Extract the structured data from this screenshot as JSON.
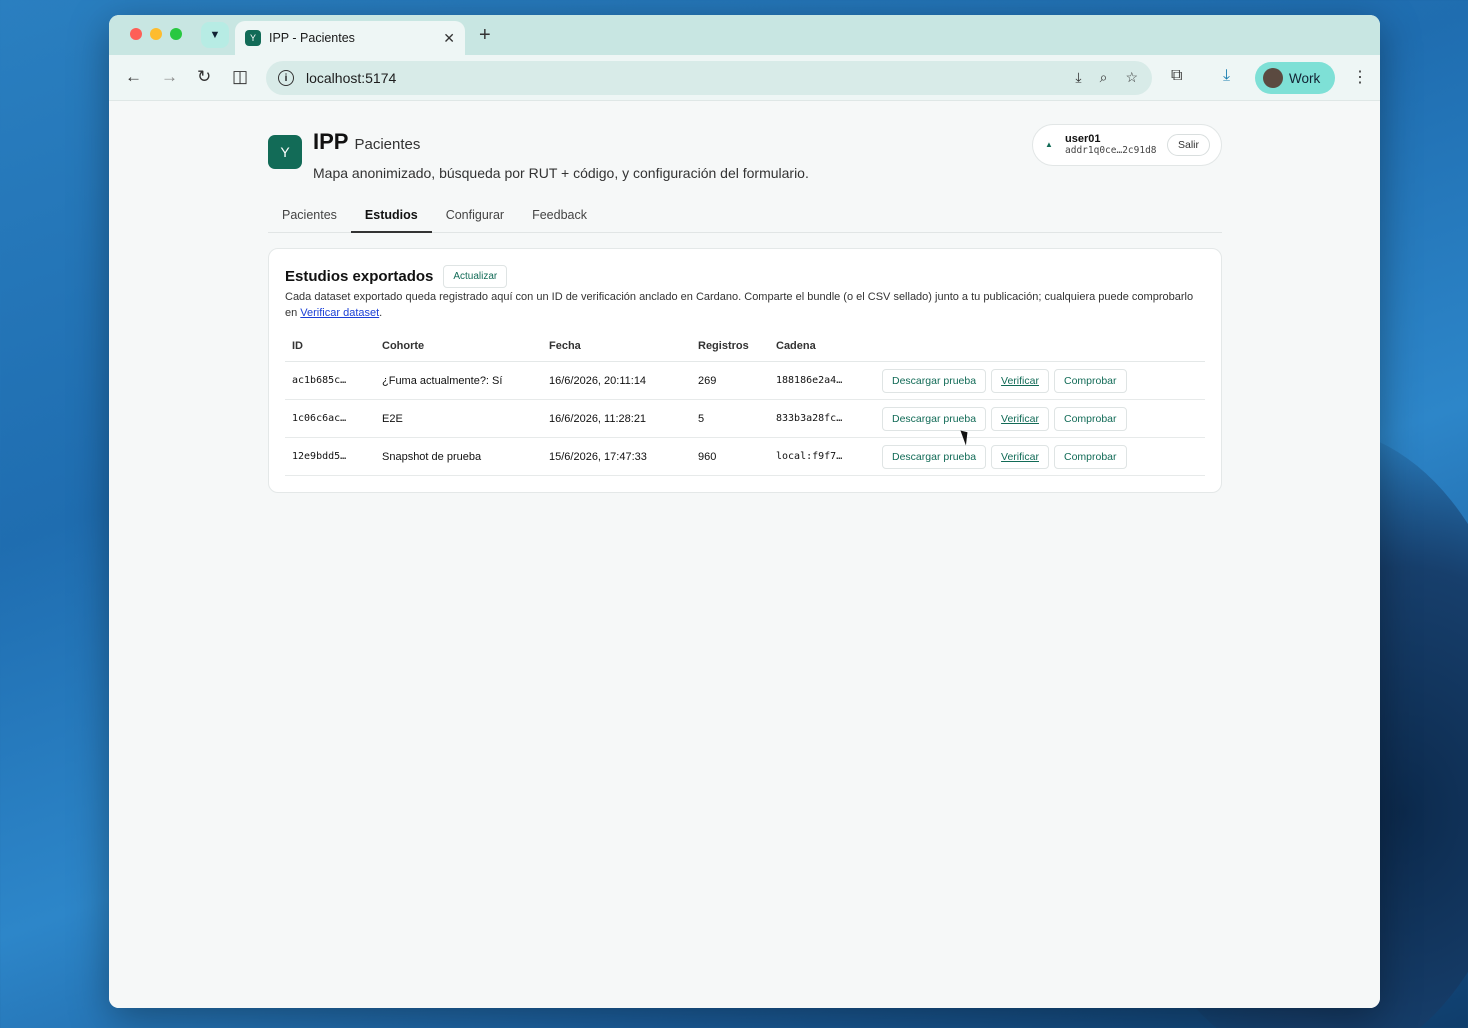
{
  "browser": {
    "tab_title": "IPP - Pacientes",
    "url": "localhost:5174",
    "profile_label": "Work"
  },
  "header": {
    "brand": "IPP",
    "brand_sub": "Pacientes",
    "tagline": "Mapa anonimizado, búsqueda por RUT + código, y configuración del formulario.",
    "user": {
      "name": "user01",
      "address": "addr1q0ce…2c91d8",
      "logout_label": "Salir"
    }
  },
  "tabs": [
    {
      "label": "Pacientes"
    },
    {
      "label": "Estudios"
    },
    {
      "label": "Configurar"
    },
    {
      "label": "Feedback"
    }
  ],
  "studies": {
    "title": "Estudios exportados",
    "refresh_label": "Actualizar",
    "description": "Cada dataset exportado queda registrado aquí con un ID de verificación anclado en Cardano. Comparte el bundle (o el CSV sellado) junto a tu publicación; cualquiera puede comprobarlo en ",
    "description_link": "Verificar dataset",
    "description_end": ".",
    "columns": [
      "ID",
      "Cohorte",
      "Fecha",
      "Registros",
      "Cadena"
    ],
    "rows": [
      {
        "id": "ac1b685c…",
        "cohort": "¿Fuma actualmente?: Sí",
        "date": "16/6/2026, 20:11:14",
        "records": "269",
        "chain": "188186e2a4…"
      },
      {
        "id": "1c06c6ac…",
        "cohort": "E2E",
        "date": "16/6/2026, 11:28:21",
        "records": "5",
        "chain": "833b3a28fc…"
      },
      {
        "id": "12e9bdd5…",
        "cohort": "Snapshot de prueba",
        "date": "15/6/2026, 17:47:33",
        "records": "960",
        "chain": "local:f9f7…"
      }
    ],
    "actions": {
      "download": "Descargar prueba",
      "verify": "Verificar",
      "check": "Comprobar"
    }
  },
  "icons": {
    "back": "←",
    "forward": "→",
    "reload": "↻",
    "close": "✕",
    "new_tab": "+",
    "menu": "⋮"
  },
  "colors": {
    "accent": "#126b57",
    "tab_bar": "#c8e6e2",
    "profile_chip": "#7ee0d6"
  }
}
